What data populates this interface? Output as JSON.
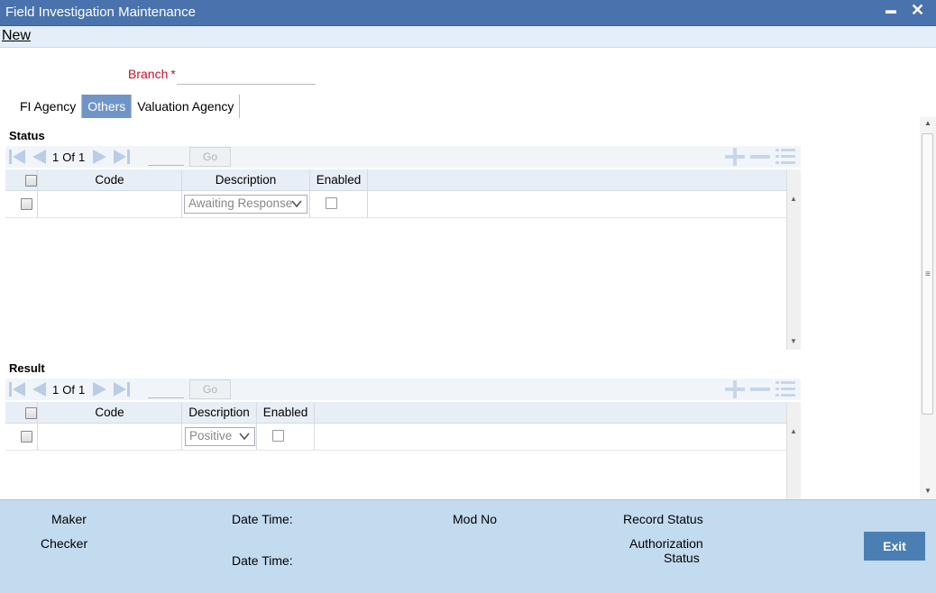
{
  "window": {
    "title": "Field Investigation Maintenance",
    "minimize_glyph": "▬",
    "close_glyph": "✕"
  },
  "menu": {
    "new_label": "New"
  },
  "form": {
    "branch_label": "Branch",
    "required_marker": "*",
    "branch_value": ""
  },
  "tabs": [
    {
      "label": "FI Agency",
      "active": false
    },
    {
      "label": "Others",
      "active": true
    },
    {
      "label": "Valuation Agency",
      "active": false
    }
  ],
  "status_grid": {
    "section_label": "Status",
    "page_current": "1",
    "page_of": "Of",
    "page_total": "1",
    "go_label": "Go",
    "columns": {
      "code": "Code",
      "description": "Description",
      "enabled": "Enabled"
    },
    "rows": [
      {
        "code": "",
        "description": "Awaiting Response",
        "enabled": false
      }
    ]
  },
  "result_grid": {
    "section_label": "Result",
    "page_current": "1",
    "page_of": "Of",
    "page_total": "1",
    "go_label": "Go",
    "columns": {
      "code": "Code",
      "description": "Description",
      "enabled": "Enabled"
    },
    "rows": [
      {
        "code": "",
        "description": "Positive",
        "enabled": false
      }
    ]
  },
  "footer": {
    "maker_label": "Maker",
    "checker_label": "Checker",
    "date_time_label": "Date Time:",
    "mod_no_label": "Mod No",
    "record_status_label": "Record Status",
    "authorization_label": "Authorization",
    "status_label": "Status",
    "exit_label": "Exit"
  },
  "colors": {
    "title_bar": "#4a72ad",
    "active_tab": "#6f95c8",
    "footer_bg": "#c3dbef",
    "exit_button": "#4b7fb3",
    "required_label": "#c8102e"
  },
  "icons": [
    "first-page-icon",
    "prev-page-icon",
    "next-page-icon",
    "last-page-icon",
    "add-row-icon",
    "delete-row-icon",
    "single-view-icon",
    "chevron-down-icon"
  ]
}
